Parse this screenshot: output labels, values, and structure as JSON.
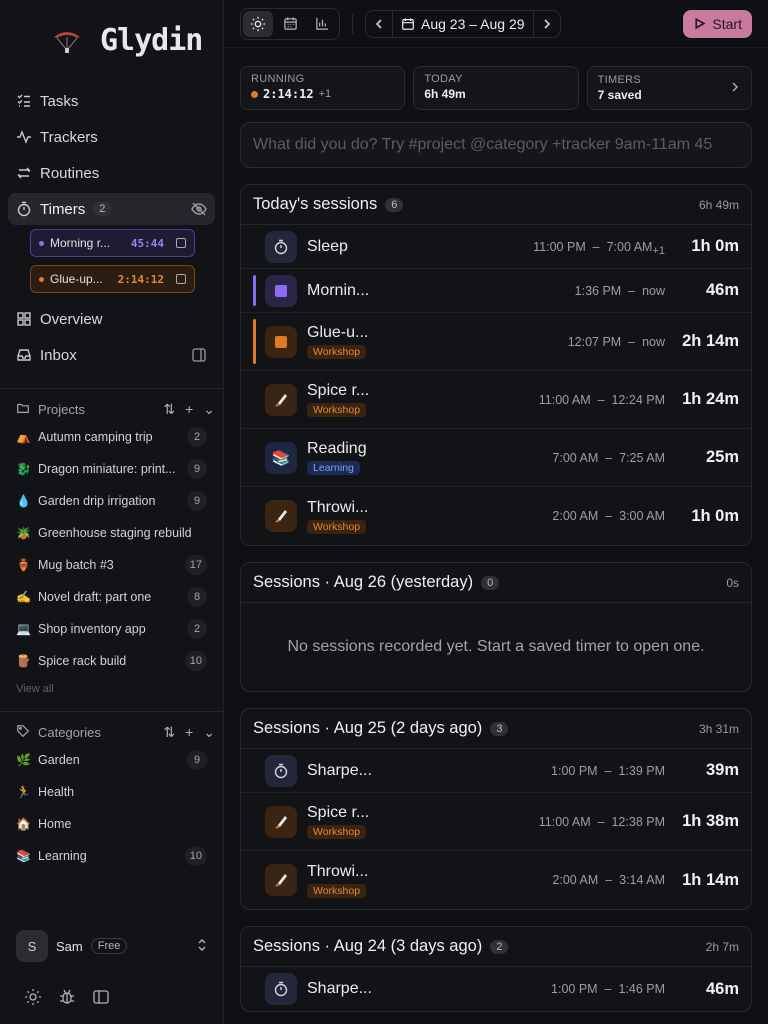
{
  "app": {
    "name": "Glydin"
  },
  "sidebar": {
    "nav": [
      {
        "label": "Tasks",
        "icon": "tasks-icon"
      },
      {
        "label": "Trackers",
        "icon": "activity-icon"
      },
      {
        "label": "Routines",
        "icon": "repeat-icon"
      },
      {
        "label": "Timers",
        "icon": "stopwatch-icon",
        "count": "2"
      }
    ],
    "running_timers": [
      {
        "label": "Morning r...",
        "time": "45:44",
        "color": "#8b6cf5"
      },
      {
        "label": "Glue-up...",
        "time": "2:14:12",
        "color": "#e07a25"
      }
    ],
    "nav2": [
      {
        "label": "Overview",
        "icon": "grid-icon"
      },
      {
        "label": "Inbox",
        "icon": "inbox-icon"
      }
    ],
    "projects_label": "Projects",
    "projects": [
      {
        "emoji": "⛺",
        "name": "Autumn camping trip",
        "count": "2"
      },
      {
        "emoji": "🐉",
        "name": "Dragon miniature: print...",
        "count": "9"
      },
      {
        "emoji": "💧",
        "name": "Garden drip irrigation",
        "count": "9"
      },
      {
        "emoji": "🪴",
        "name": "Greenhouse staging rebuild",
        "count": ""
      },
      {
        "emoji": "🏺",
        "name": "Mug batch #3",
        "count": "17"
      },
      {
        "emoji": "✍️",
        "name": "Novel draft: part one",
        "count": "8"
      },
      {
        "emoji": "💻",
        "name": "Shop inventory app",
        "count": "2"
      },
      {
        "emoji": "🪵",
        "name": "Spice rack build",
        "count": "10"
      }
    ],
    "view_all": "View all",
    "categories_label": "Categories",
    "categories": [
      {
        "emoji": "🌿",
        "name": "Garden",
        "count": "9"
      },
      {
        "emoji": "🏃",
        "name": "Health",
        "count": ""
      },
      {
        "emoji": "🏠",
        "name": "Home",
        "count": ""
      },
      {
        "emoji": "📚",
        "name": "Learning",
        "count": "10"
      }
    ],
    "user": {
      "initial": "S",
      "name": "Sam",
      "plan": "Free"
    }
  },
  "topbar": {
    "date_range": "Aug 23 – Aug 29",
    "start_label": "Start"
  },
  "stats": {
    "running_label": "RUNNING",
    "running_value": "2:14:12",
    "running_extra": "+1",
    "today_label": "TODAY",
    "today_value": "6h 49m",
    "timers_label": "TIMERS",
    "timers_value": "7 saved"
  },
  "quick_input": {
    "placeholder": "What did you do? Try #project @category +tracker 9am-11am 45"
  },
  "colors": {
    "accent": "#c87b9f",
    "running": "#e07a25",
    "purple": "#8b6cf5",
    "workshop": "#e0883a",
    "learning": "#7aa0f2"
  },
  "days": [
    {
      "title": "Today's sessions",
      "count": "6",
      "total": "6h 49m",
      "sessions": [
        {
          "name": "Sleep",
          "icon": "stopwatch",
          "iconClass": "neutral",
          "start": "11:00 PM",
          "end": "7:00 AM",
          "plus": "+1",
          "dur": "1h 0m"
        },
        {
          "name": "Mornin...",
          "icon": "square",
          "iconClass": "purple",
          "bar": "#8b6cf5",
          "start": "1:36 PM",
          "end": "now",
          "dur": "46m"
        },
        {
          "name": "Glue-u...",
          "icon": "square",
          "iconClass": "orange",
          "bar": "#e07a25",
          "tag": "Workshop",
          "tagClass": "workshop",
          "start": "12:07 PM",
          "end": "now",
          "dur": "2h 14m"
        },
        {
          "name": "Spice r...",
          "icon": "knife",
          "iconClass": "orange",
          "tag": "Workshop",
          "tagClass": "workshop",
          "start": "11:00 AM",
          "end": "12:24 PM",
          "dur": "1h 24m"
        },
        {
          "name": "Reading",
          "icon": "books",
          "iconClass": "blue",
          "tag": "Learning",
          "tagClass": "learning",
          "start": "7:00 AM",
          "end": "7:25 AM",
          "dur": "25m"
        },
        {
          "name": "Throwi...",
          "icon": "knife",
          "iconClass": "orange",
          "tag": "Workshop",
          "tagClass": "workshop",
          "start": "2:00 AM",
          "end": "3:00 AM",
          "dur": "1h 0m"
        }
      ]
    },
    {
      "title": "Sessions · Aug 26 (yesterday)",
      "count": "0",
      "total": "0s",
      "empty": "No sessions recorded yet. Start a saved timer to open one.",
      "sessions": []
    },
    {
      "title": "Sessions · Aug 25 (2 days ago)",
      "count": "3",
      "total": "3h 31m",
      "sessions": [
        {
          "name": "Sharpe...",
          "icon": "stopwatch",
          "iconClass": "neutral",
          "start": "1:00 PM",
          "end": "1:39 PM",
          "dur": "39m"
        },
        {
          "name": "Spice r...",
          "icon": "knife",
          "iconClass": "orange",
          "tag": "Workshop",
          "tagClass": "workshop",
          "start": "11:00 AM",
          "end": "12:38 PM",
          "dur": "1h 38m"
        },
        {
          "name": "Throwi...",
          "icon": "knife",
          "iconClass": "orange",
          "tag": "Workshop",
          "tagClass": "workshop",
          "start": "2:00 AM",
          "end": "3:14 AM",
          "dur": "1h 14m"
        }
      ]
    },
    {
      "title": "Sessions · Aug 24 (3 days ago)",
      "count": "2",
      "total": "2h 7m",
      "sessions": [
        {
          "name": "Sharpe...",
          "icon": "stopwatch",
          "iconClass": "neutral",
          "start": "1:00 PM",
          "end": "1:46 PM",
          "dur": "46m"
        }
      ]
    }
  ]
}
